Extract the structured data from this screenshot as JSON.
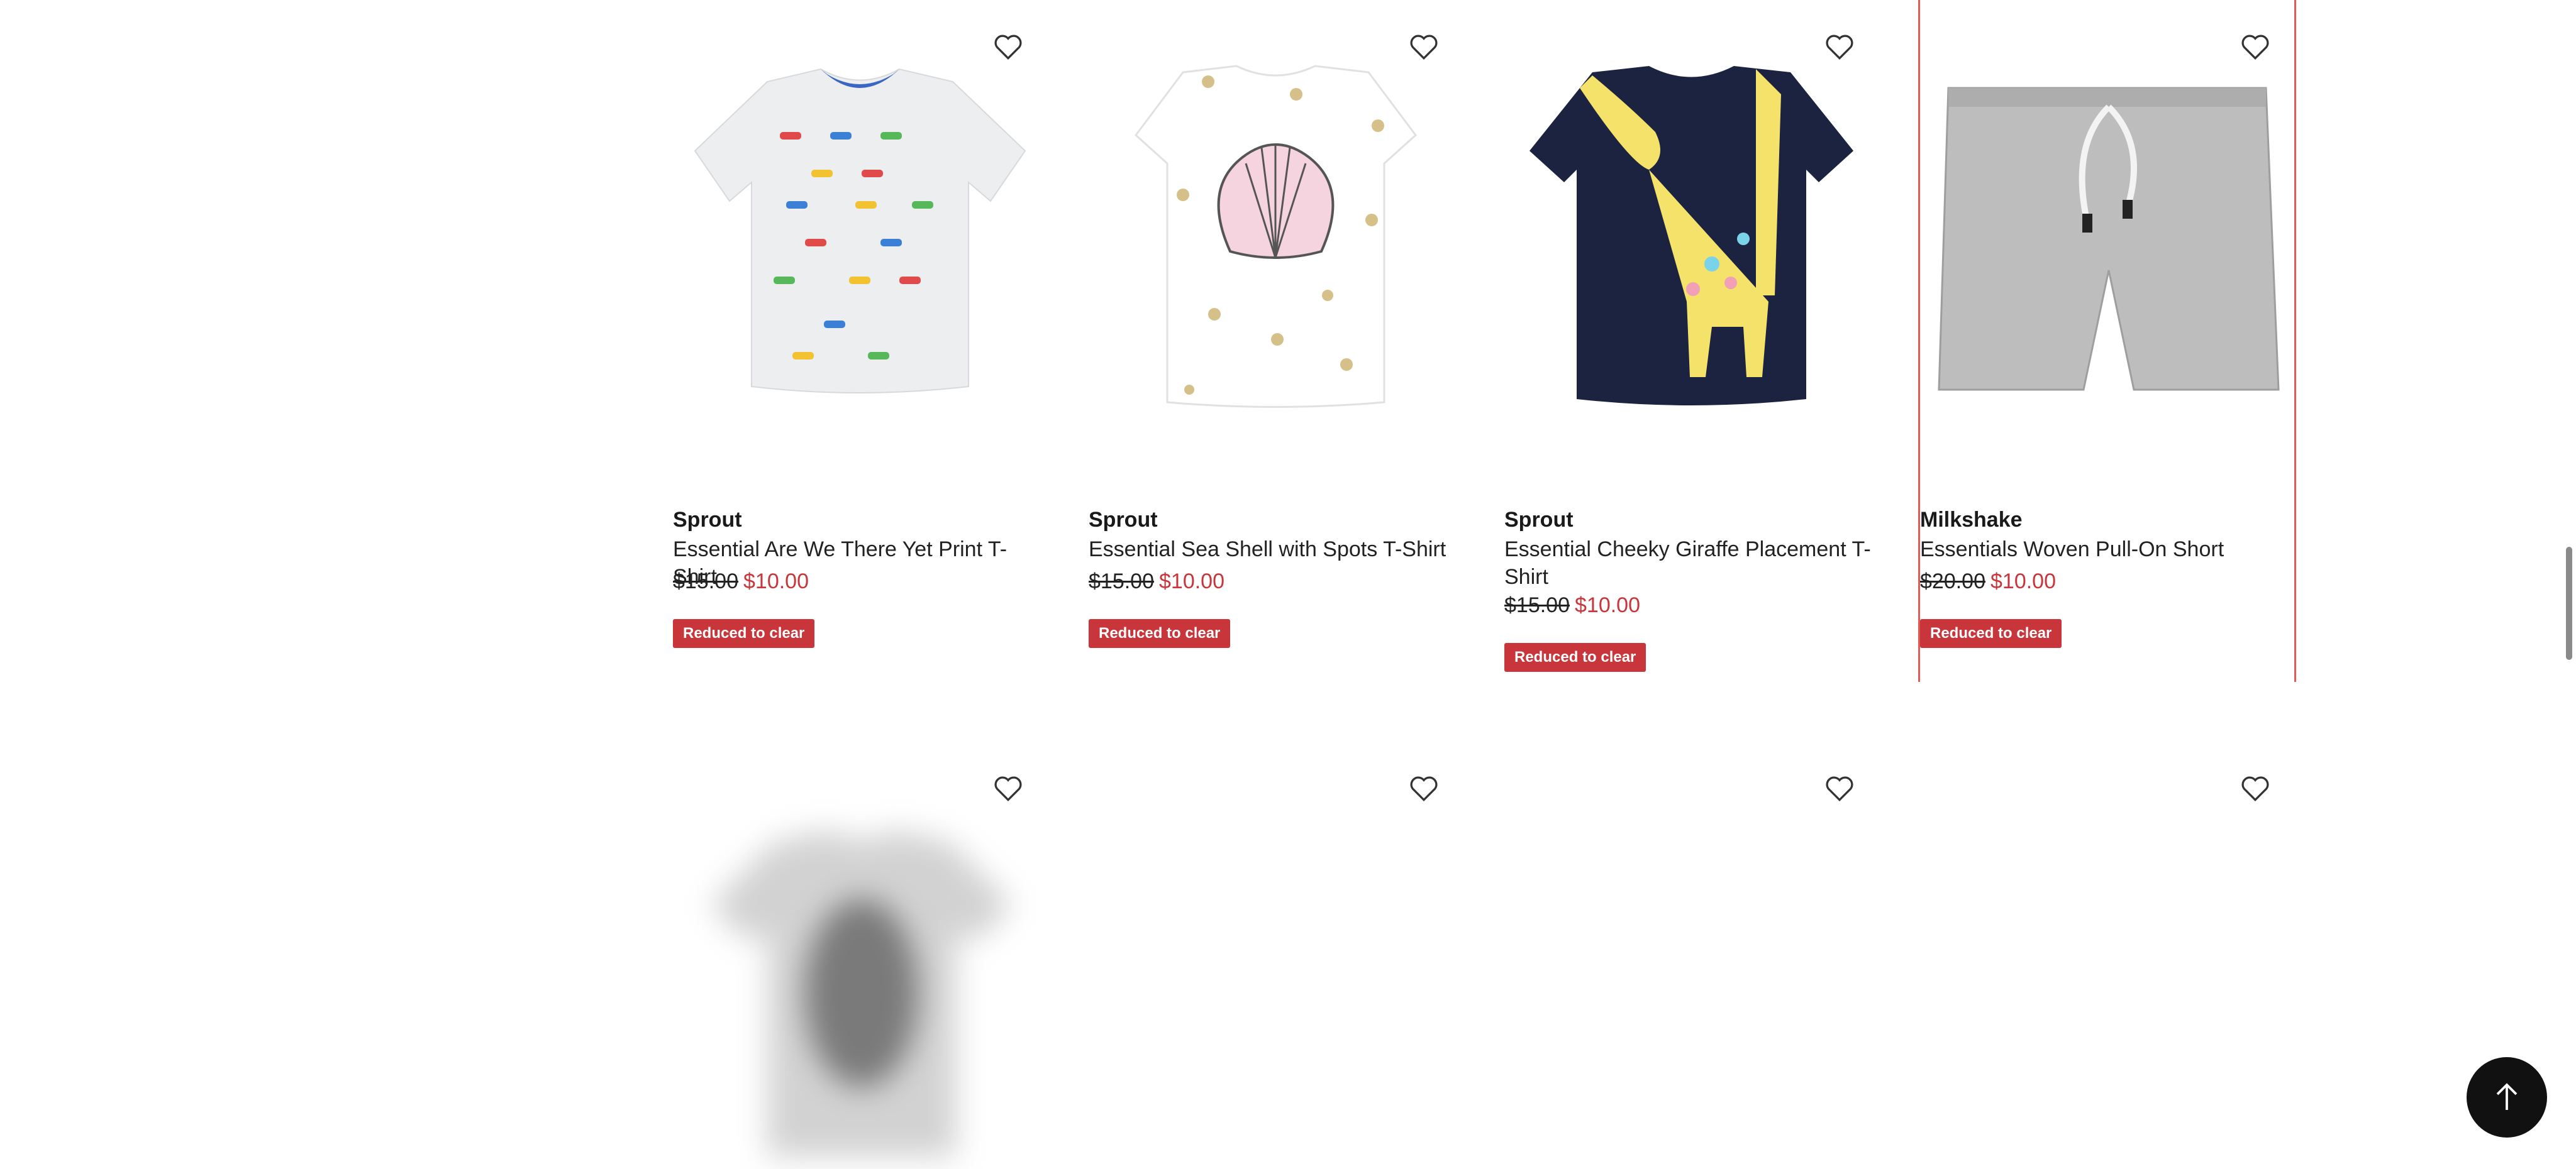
{
  "wishlist_icon": "heart-outline-icon",
  "colors": {
    "sale_red": "#c8353a",
    "selected_border": "#e05a5a"
  },
  "products": [
    {
      "brand": "Sprout",
      "title": "Essential Are We There Yet Print T-Shirt",
      "old_price": "$15.00",
      "new_price": "$10.00",
      "badge": "Reduced to clear"
    },
    {
      "brand": "Sprout",
      "title": "Essential Sea Shell with Spots T-Shirt",
      "old_price": "$15.00",
      "new_price": "$10.00",
      "badge": "Reduced to clear"
    },
    {
      "brand": "Sprout",
      "title": "Essential Cheeky Giraffe Placement T-Shirt",
      "old_price": "$15.00",
      "new_price": "$10.00",
      "badge": "Reduced to clear"
    },
    {
      "brand": "Milkshake",
      "title": "Essentials Woven Pull-On Short",
      "old_price": "$20.00",
      "new_price": "$10.00",
      "badge": "Reduced to clear"
    }
  ],
  "back_to_top_icon": "arrow-up-icon"
}
